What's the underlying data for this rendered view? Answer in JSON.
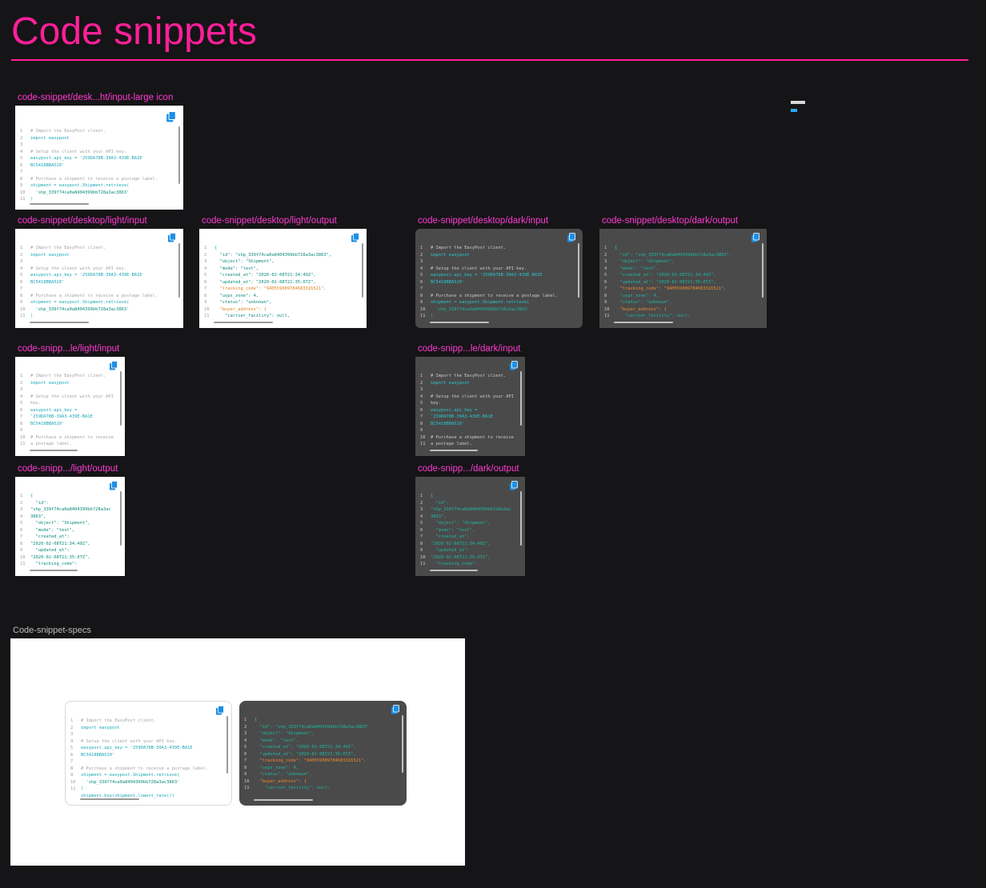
{
  "page": {
    "title": "Code snippets"
  },
  "labels": {
    "large_icon": "code-snippet/desk...ht/input-large icon",
    "desktop_light_input": "code-snippet/desktop/light/input",
    "desktop_light_output": "code-snippet/desktop/light/output",
    "desktop_dark_input": "code-snippet/desktop/dark/input",
    "desktop_dark_output": "code-snippet/desktop/dark/output",
    "mobile_light_input": "code-snipp...le/light/input",
    "mobile_dark_input": "code-snipp...le/dark/input",
    "mobile_light_output": "code-snipp.../light/output",
    "mobile_dark_output": "code-snipp.../dark/output",
    "specs": "Code-snippet-specs"
  },
  "icons": {
    "copy": "copy-icon"
  },
  "colors": {
    "accent": "#ff1f9a",
    "background": "#151416",
    "dark_snippet": "#4a4a4a",
    "light_snippet": "#ffffff",
    "copy_icon": "#1b8fe6"
  },
  "code": {
    "input_desktop": [
      {
        "n": "1",
        "t": "# Import the EasyPost client.",
        "c": "c"
      },
      {
        "n": "2",
        "t": "import easypost",
        "c": "k"
      },
      {
        "n": "3",
        "t": "",
        "c": "p"
      },
      {
        "n": "4",
        "t": "# Setup the client with your API key.",
        "c": "c"
      },
      {
        "n": "5",
        "t": "easypost.api_key = '259DA78B-39A3-439E-BA1E",
        "c": "k"
      },
      {
        "n": "6",
        "t": "BC5418BBA520'",
        "c": "k"
      },
      {
        "n": "7",
        "t": "",
        "c": "p"
      },
      {
        "n": "8",
        "t": "# Purchase a shipment to receive a postage label.",
        "c": "c"
      },
      {
        "n": "9",
        "t": "shipment = easypost.Shipment.retrieve(",
        "c": "k"
      },
      {
        "n": "10",
        "t": "  'shp_339f74ca0a8404399bb728a3ac3863'",
        "c": "s"
      },
      {
        "n": "11",
        "t": ")",
        "c": "k"
      }
    ],
    "output_desktop": [
      {
        "n": "1",
        "t": "{",
        "c": "k"
      },
      {
        "n": "2",
        "t": "  \"id\": \"shp_339f74ca0a8404399bb728a3ac3863\",",
        "c": "s"
      },
      {
        "n": "3",
        "t": "  \"object\": \"Shipment\",",
        "c": "s"
      },
      {
        "n": "4",
        "t": "  \"mode\": \"test\",",
        "c": "s"
      },
      {
        "n": "5",
        "t": "  \"created_at\": \"2020-02-08T21:34:49Z\",",
        "c": "s"
      },
      {
        "n": "6",
        "t": "  \"updated_at\": \"2020-02-08T21:35:07Z\",",
        "c": "s"
      },
      {
        "n": "7",
        "t": "  \"tracking_code\": \"940559089784683316521\",",
        "c": "o"
      },
      {
        "n": "8",
        "t": "  \"usps_zone\": 4,",
        "c": "s"
      },
      {
        "n": "9",
        "t": "  \"status\": \"unknown\",",
        "c": "s"
      },
      {
        "n": "10",
        "t": "  \"buyer_address\": {",
        "c": "o"
      },
      {
        "n": "11",
        "t": "    \"carrier_facility\": null,",
        "c": "s"
      }
    ],
    "input_mobile": [
      {
        "n": "1",
        "t": "# Import the EasyPost client.",
        "c": "c"
      },
      {
        "n": "2",
        "t": "import easypost",
        "c": "k"
      },
      {
        "n": "3",
        "t": "",
        "c": "p"
      },
      {
        "n": "4",
        "t": "# Setup the client with your API",
        "c": "c"
      },
      {
        "n": "5",
        "t": "key.",
        "c": "c"
      },
      {
        "n": "6",
        "t": "easypost.api_key =",
        "c": "k"
      },
      {
        "n": "7",
        "t": "'259DA78B-39A3-439E-BA1E",
        "c": "k"
      },
      {
        "n": "8",
        "t": "BC5418BBA520'",
        "c": "k"
      },
      {
        "n": "9",
        "t": "",
        "c": "p"
      },
      {
        "n": "10",
        "t": "# Purchase a shipment to receive",
        "c": "c"
      },
      {
        "n": "11",
        "t": "a postage label.",
        "c": "c"
      }
    ],
    "output_mobile": [
      {
        "n": "1",
        "t": "{",
        "c": "k"
      },
      {
        "n": "2",
        "t": "  \"id\":",
        "c": "s"
      },
      {
        "n": "3",
        "t": "\"shp_339f74ca0a8404399bb728a3ac",
        "c": "s"
      },
      {
        "n": "4",
        "t": "3863\",",
        "c": "s"
      },
      {
        "n": "5",
        "t": "  \"object\": \"Shipment\",",
        "c": "s"
      },
      {
        "n": "6",
        "t": "  \"mode\": \"test\",",
        "c": "s"
      },
      {
        "n": "7",
        "t": "  \"created_at\":",
        "c": "s"
      },
      {
        "n": "8",
        "t": "\"2020-02-08T21:34:49Z\",",
        "c": "s"
      },
      {
        "n": "9",
        "t": "  \"updated_at\":",
        "c": "s"
      },
      {
        "n": "10",
        "t": "\"2020-02-08T21:35:07Z\",",
        "c": "s"
      },
      {
        "n": "11",
        "t": "  \"tracking_code\":",
        "c": "s"
      }
    ],
    "input_spec": [
      {
        "n": "1",
        "t": "# Import the EasyPost client.",
        "c": "c"
      },
      {
        "n": "2",
        "t": "import easypost",
        "c": "k"
      },
      {
        "n": "3",
        "t": "",
        "c": "p"
      },
      {
        "n": "4",
        "t": "# Setup the client with your API key.",
        "c": "c"
      },
      {
        "n": "5",
        "t": "easypost.api_key = '259DA78B-39A3-439E-BA1E",
        "c": "k"
      },
      {
        "n": "6",
        "t": "BC5418BBA520'",
        "c": "k"
      },
      {
        "n": "7",
        "t": "",
        "c": "p"
      },
      {
        "n": "8",
        "t": "# Purchase a shipment to receive a postage label.",
        "c": "c"
      },
      {
        "n": "9",
        "t": "shipment = easypost.Shipment.retrieve(",
        "c": "k"
      },
      {
        "n": "10",
        "t": "  'shp_339f74ca0a8404399bb728a3ac3863'",
        "c": "s"
      },
      {
        "n": "11",
        "t": ")",
        "c": "k"
      },
      {
        "n": "",
        "t": "shipment.buy(shipment.lowest_rate())",
        "c": "k"
      }
    ]
  }
}
